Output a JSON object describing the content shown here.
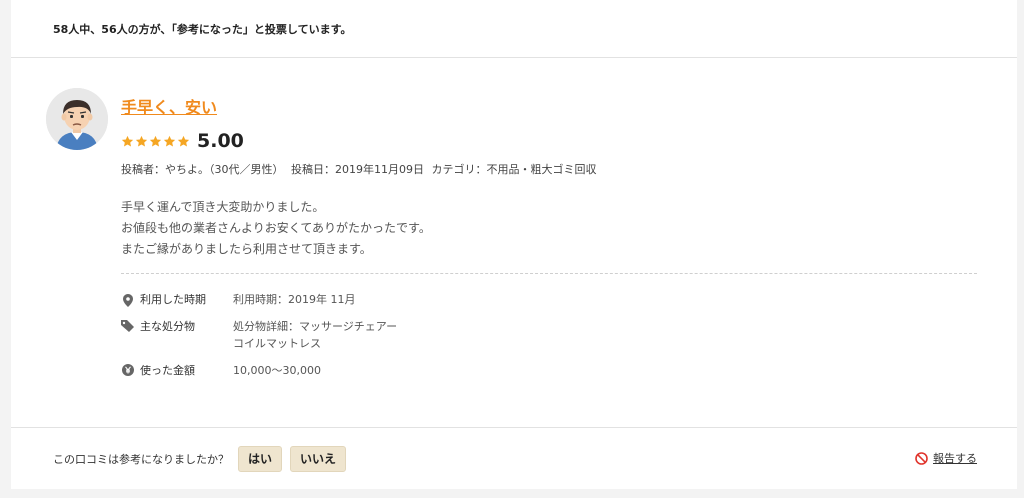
{
  "vote_summary": "58人中、56人の方が、「参考になった」と投票しています。",
  "review": {
    "title": "手早く、安い",
    "rating": 5,
    "rating_max": 5,
    "score": "5.00",
    "star_color": "#f5a623",
    "meta": {
      "author": "投稿者：やちよ。（30代／男性）",
      "date": "投稿日：2019年11月09日",
      "category": "カテゴリ：不用品・粗大ゴミ回収"
    },
    "text_lines": [
      "手早く運んで頂き大変助かりました。",
      "お値段も他の業者さんよりお安くてありがたかったです。",
      "またご縁がありましたら利用させて頂きます。"
    ],
    "details": [
      {
        "icon": "location-pin-icon",
        "label": "利用した時期",
        "values": [
          "利用時期：2019年 11月"
        ]
      },
      {
        "icon": "tag-icon",
        "label": "主な処分物",
        "values": [
          "処分物詳細：マッサージチェアー",
          "コイルマットレス"
        ]
      },
      {
        "icon": "yen-icon",
        "label": "使った金額",
        "values": [
          "10,000〜30,000"
        ]
      }
    ]
  },
  "footer": {
    "question": "この口コミは参考になりましたか？",
    "yes_label": "はい",
    "no_label": "いいえ",
    "report_label": "報告する"
  },
  "colors": {
    "accent": "#f08a1d",
    "button_bg": "#efe5cf",
    "report_icon": "#e0342c"
  }
}
